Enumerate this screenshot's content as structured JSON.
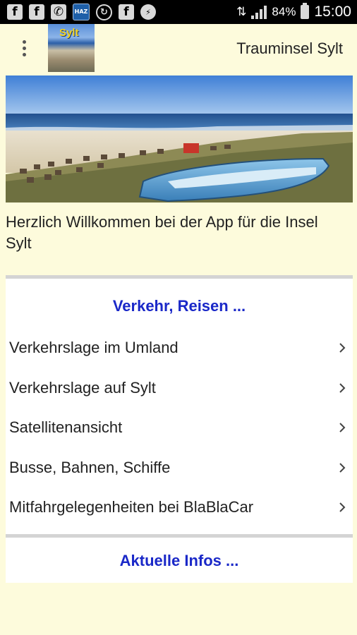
{
  "status_bar": {
    "battery_percent": "84%",
    "time": "15:00",
    "left_icons": [
      "facebook-icon",
      "facebook-icon",
      "whatsapp-icon",
      "haz-app-icon",
      "sync-icon",
      "facebook-icon",
      "messenger-icon"
    ]
  },
  "appbar": {
    "logo_text": "Sylt",
    "title": "Trauminsel Sylt"
  },
  "welcome_text": "Herzlich Willkommen bei der App für die Insel Sylt",
  "section1": {
    "header": "Verkehr, Reisen ...",
    "items": [
      {
        "label": "Verkehrslage im Umland"
      },
      {
        "label": "Verkehrslage auf Sylt"
      },
      {
        "label": "Satellitenansicht"
      },
      {
        "label": "Busse, Bahnen, Schiffe"
      },
      {
        "label": "Mitfahrgelegenheiten bei BlaBlaCar"
      }
    ]
  },
  "section2": {
    "header": "Aktuelle Infos ..."
  },
  "colors": {
    "background": "#fdfbdc",
    "section_header": "#1a28c8",
    "status_bar": "#000000"
  }
}
